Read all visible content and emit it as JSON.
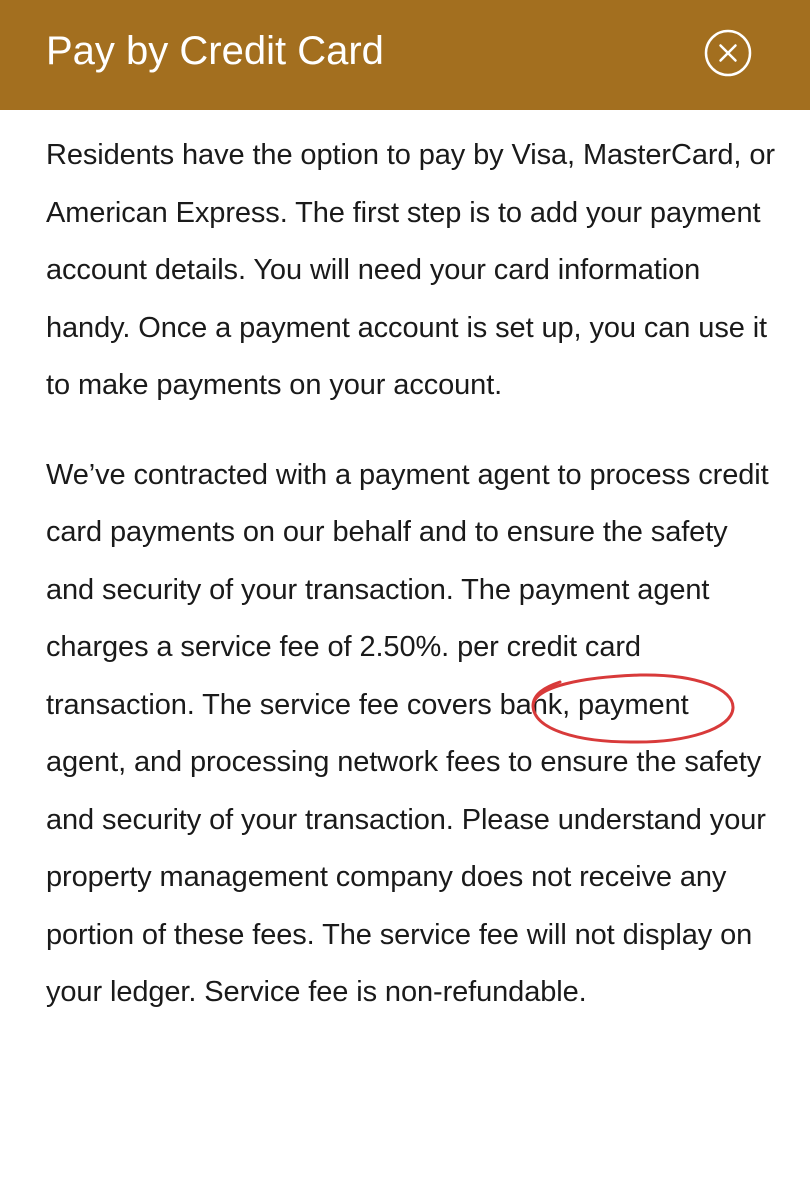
{
  "dialog": {
    "title": "Pay by Credit Card",
    "close_icon": "close-circle-icon"
  },
  "content": {
    "paragraph_1": "Residents have the option to pay by Visa, MasterCard, or American Express. The first step is to add your payment account details. You will need your card information handy. Once a payment account is set up, you can use it to make payments on your account.",
    "paragraph_2": "We’ve contracted with a payment agent to process credit card payments on our behalf and to ensure the safety and security of your transaction. The payment agent charges a service fee of 2.50%. per credit card transaction. The service fee covers bank, payment agent, and processing network fees to ensure the safety and security of your transaction. Please understand your property management company does not receive any portion of these fees. The service fee will not display on your ledger. Service fee is non-refundable."
  },
  "colors": {
    "header_background": "#a36f1f",
    "header_text": "#ffffff",
    "annotation": "#d83a3a"
  }
}
